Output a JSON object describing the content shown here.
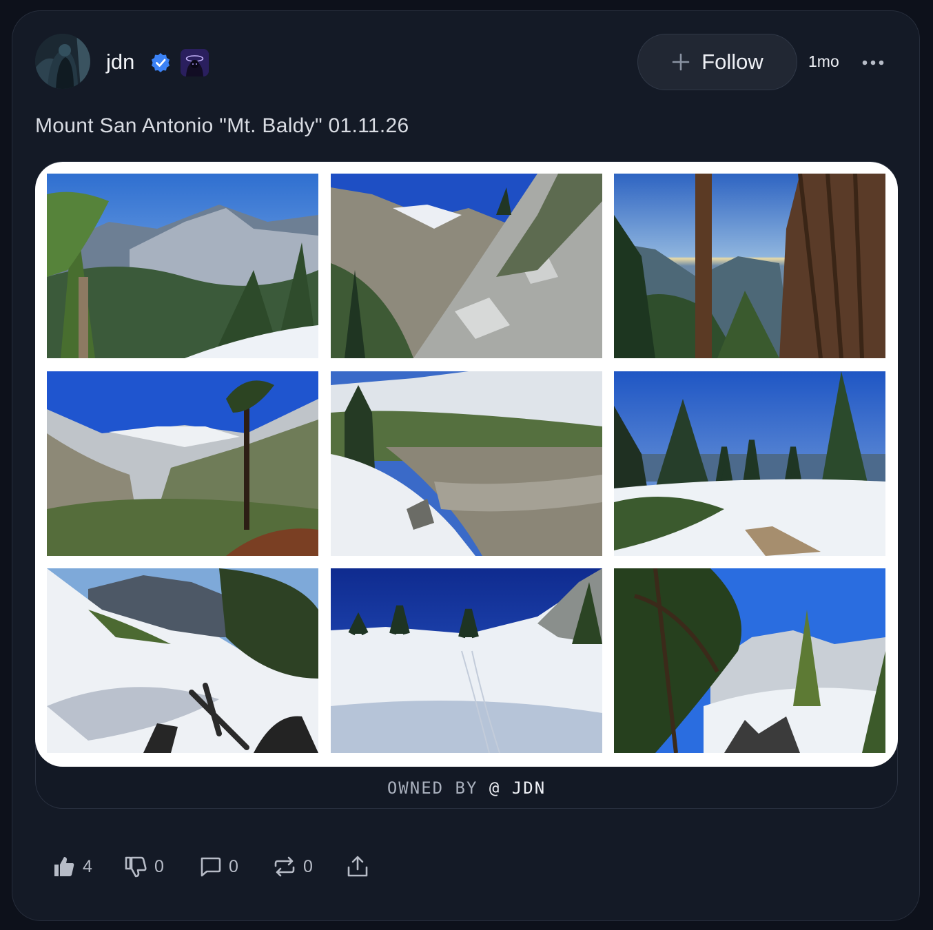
{
  "post": {
    "author": {
      "username": "jdn",
      "verified": true
    },
    "follow_label": "Follow",
    "timestamp": "1mo",
    "text": "Mount San Antonio \"Mt. Baldy\" 01.11.26",
    "owned_by": {
      "prefix": "OWNED BY",
      "handle": "@ JDN"
    },
    "gallery": [
      {
        "scene": "pine-ridge-overlook"
      },
      {
        "scene": "rocky-scree-slope"
      },
      {
        "scene": "tree-trunk-valley"
      },
      {
        "scene": "snowy-bowl-ridge"
      },
      {
        "scene": "snow-gully-rocks"
      },
      {
        "scene": "snowfield-pines-sea"
      },
      {
        "scene": "snow-slope-trekking-poles"
      },
      {
        "scene": "snow-bowl-tracks"
      },
      {
        "scene": "pine-branch-snow-ridge"
      }
    ],
    "actions": {
      "likes": "4",
      "dislikes": "0",
      "comments": "0",
      "reposts": "0"
    }
  },
  "colors": {
    "background": "#0d111b",
    "card": "#141a26",
    "verified_blue": "#3b82f6",
    "follow_button": "#212733"
  },
  "icons": [
    "more-icon",
    "verified-icon",
    "plus-icon",
    "thumbs-up-icon",
    "thumbs-down-icon",
    "comment-icon",
    "repost-icon",
    "share-icon"
  ]
}
